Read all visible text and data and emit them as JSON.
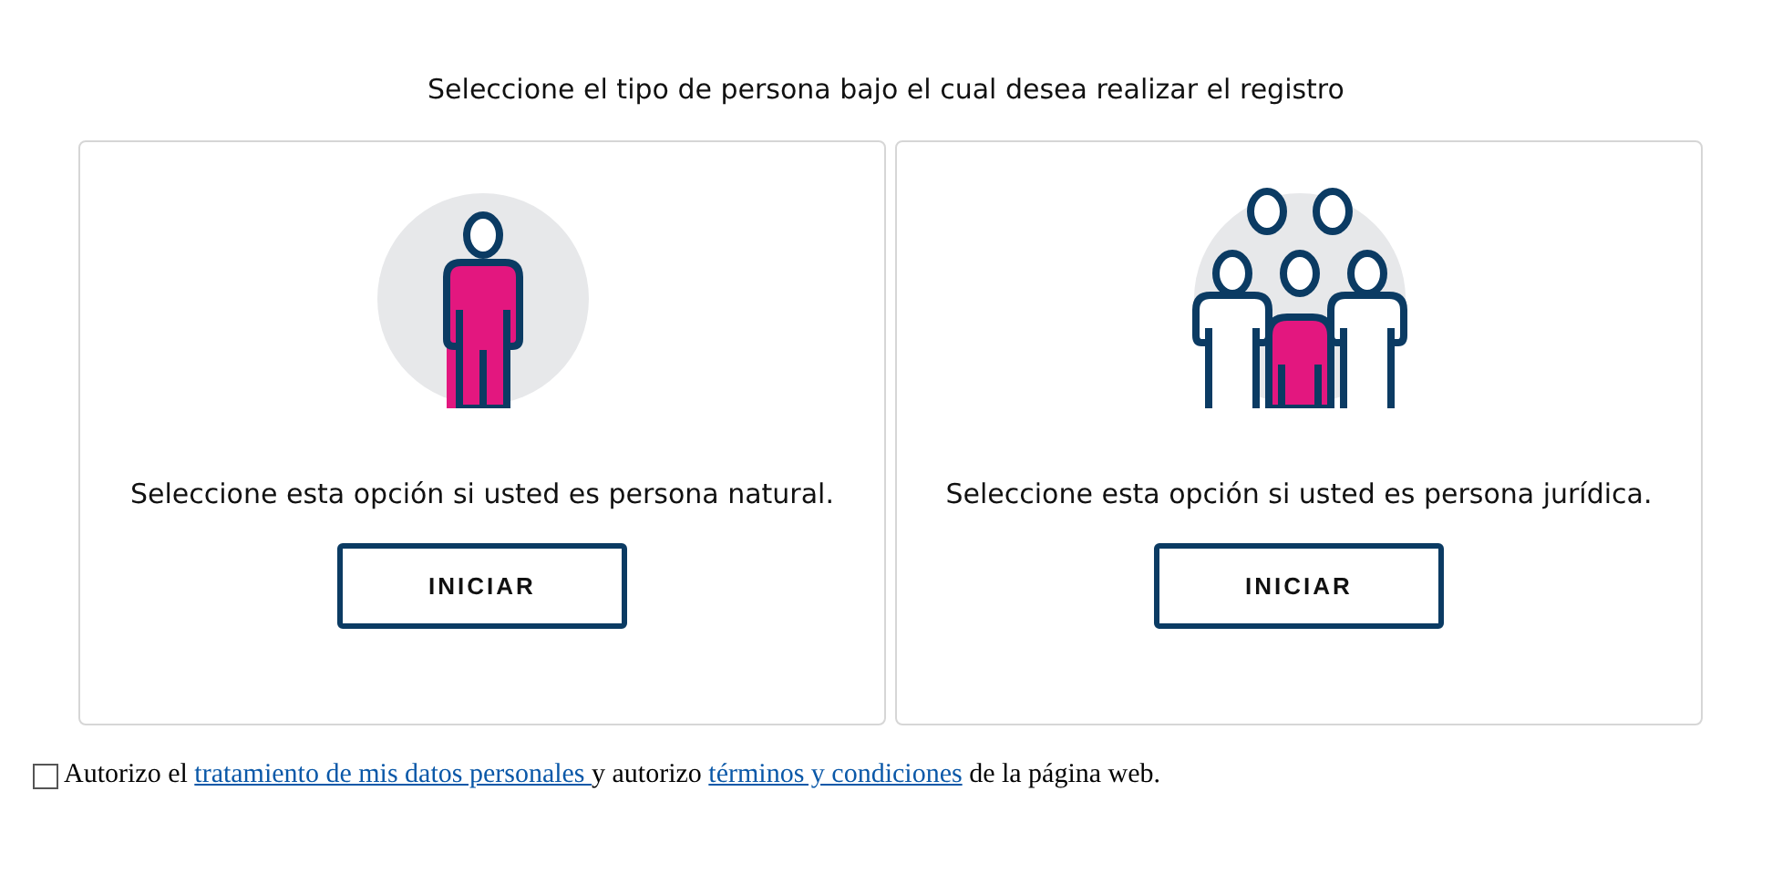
{
  "heading": "Seleccione el tipo de persona bajo el cual desea realizar el registro",
  "options": [
    {
      "kind": "single",
      "description": "Seleccione esta opción si usted es persona natural.",
      "button": "INICIAR"
    },
    {
      "kind": "group",
      "description": "Seleccione esta opción si usted es persona jurídica.",
      "button": "INICIAR"
    }
  ],
  "consent": {
    "checked": false,
    "parts": [
      {
        "kind": "text",
        "text": "Autorizo el "
      },
      {
        "kind": "link",
        "text": "tratamiento de mis datos personales "
      },
      {
        "kind": "text",
        "text": "y autorizo "
      },
      {
        "kind": "link",
        "text": "términos y condiciones"
      },
      {
        "kind": "text",
        "text": " de la página web."
      }
    ]
  }
}
